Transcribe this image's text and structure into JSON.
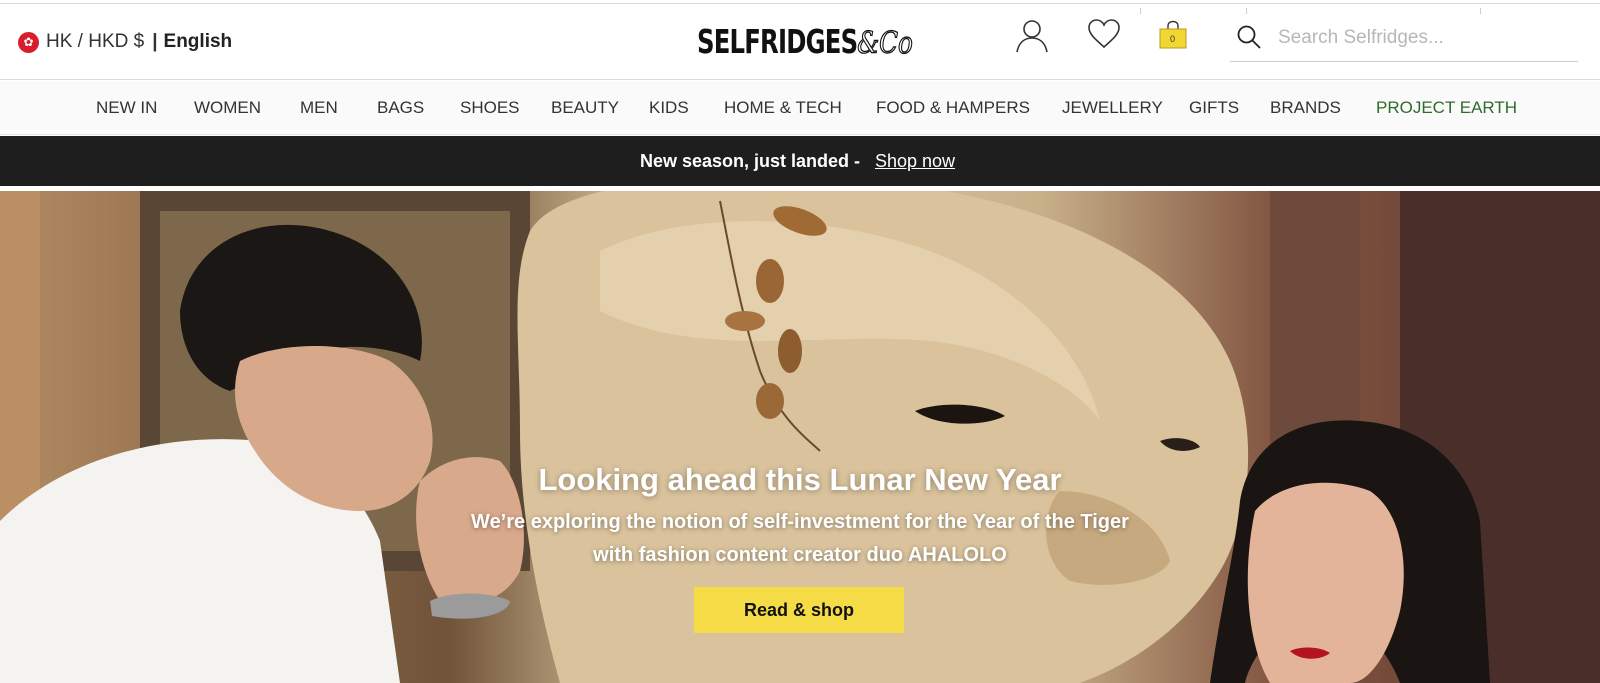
{
  "header": {
    "locale": {
      "region": "HK / HKD $",
      "separator": "|",
      "language": "English"
    },
    "logo_text": "SELFRIDGES",
    "logo_suffix": "&Co",
    "bag_count": "0",
    "search": {
      "placeholder": "Search Selfridges..."
    }
  },
  "nav": {
    "items": [
      "NEW IN",
      "WOMEN",
      "MEN",
      "BAGS",
      "SHOES",
      "BEAUTY",
      "KIDS",
      "HOME & TECH",
      "FOOD & HAMPERS",
      "JEWELLERY",
      "GIFTS",
      "BRANDS",
      "PROJECT EARTH"
    ]
  },
  "promo": {
    "text": "New season, just landed -",
    "link": "Shop now"
  },
  "hero": {
    "title": "Looking ahead this Lunar New Year",
    "subtitle_line1": "We’re exploring the notion of self-investment for the Year of the Tiger",
    "subtitle_line2": "with fashion content creator duo AHALOLO",
    "cta": "Read & shop"
  },
  "colors": {
    "promo_bg": "#1e1e1e",
    "cta": "#f5dc46",
    "project_earth": "#2f6b2a",
    "flag": "#d81e2a"
  }
}
